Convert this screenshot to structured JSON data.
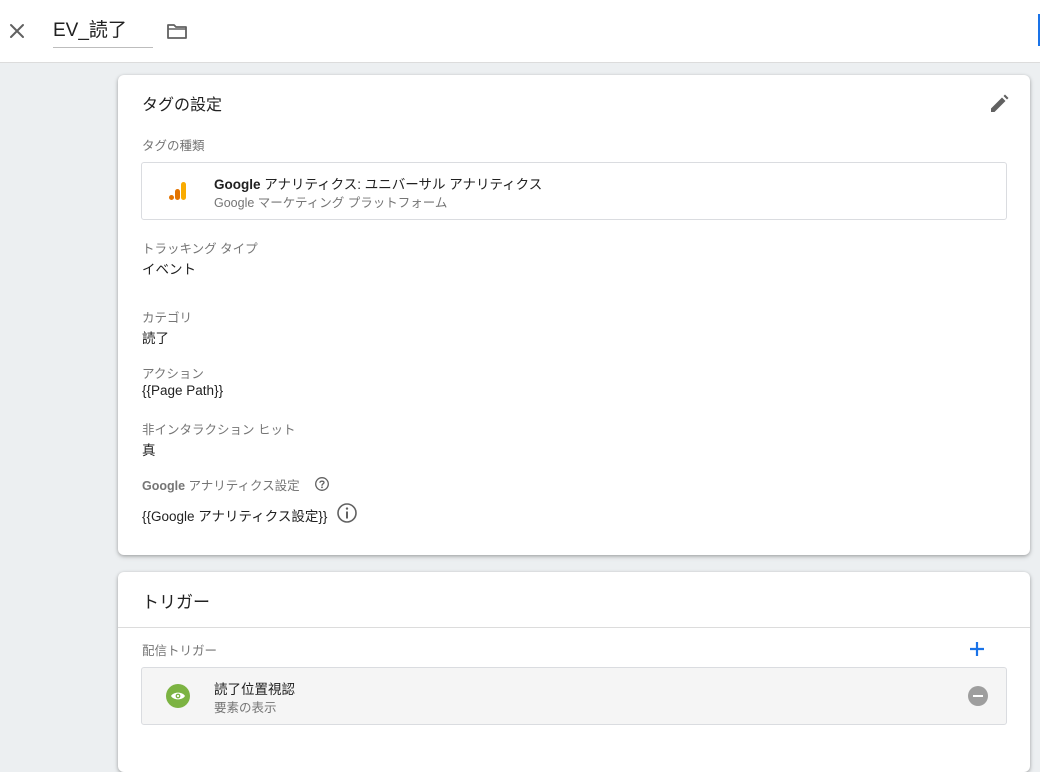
{
  "header": {
    "tag_name": "EV_読了",
    "close_icon": "close-icon",
    "folder_icon": "folder-icon",
    "accent_color": "#1a73e8"
  },
  "tag_config": {
    "title": "タグの設定",
    "edit_icon": "pencil-icon",
    "tag_type_label": "タグの種類",
    "tag_type": {
      "name_bold": "Google",
      "name_rest": " アナリティクス: ユニバーサル アナリティクス",
      "vendor": "Google マーケティング プラットフォーム",
      "icon": "google-analytics-icon"
    },
    "fields": [
      {
        "label": "トラッキング タイプ",
        "value": "イベント"
      },
      {
        "label": "カテゴリ",
        "value": "読了"
      },
      {
        "label": "アクション",
        "value": "{{Page Path}}"
      },
      {
        "label": "非インタラクション ヒット",
        "value": "真"
      }
    ],
    "ga_settings": {
      "label_bold": "Google",
      "label_rest": " アナリティクス設定",
      "value": "{{Google アナリティクス設定}}",
      "help_icon": "help-icon",
      "info_icon": "info-icon"
    }
  },
  "trigger": {
    "title": "トリガー",
    "firing_label": "配信トリガー",
    "add_icon": "plus-icon",
    "items": [
      {
        "name": "読了位置視認",
        "type": "要素の表示",
        "icon": "eye-icon",
        "color": "#7cb342"
      }
    ]
  }
}
